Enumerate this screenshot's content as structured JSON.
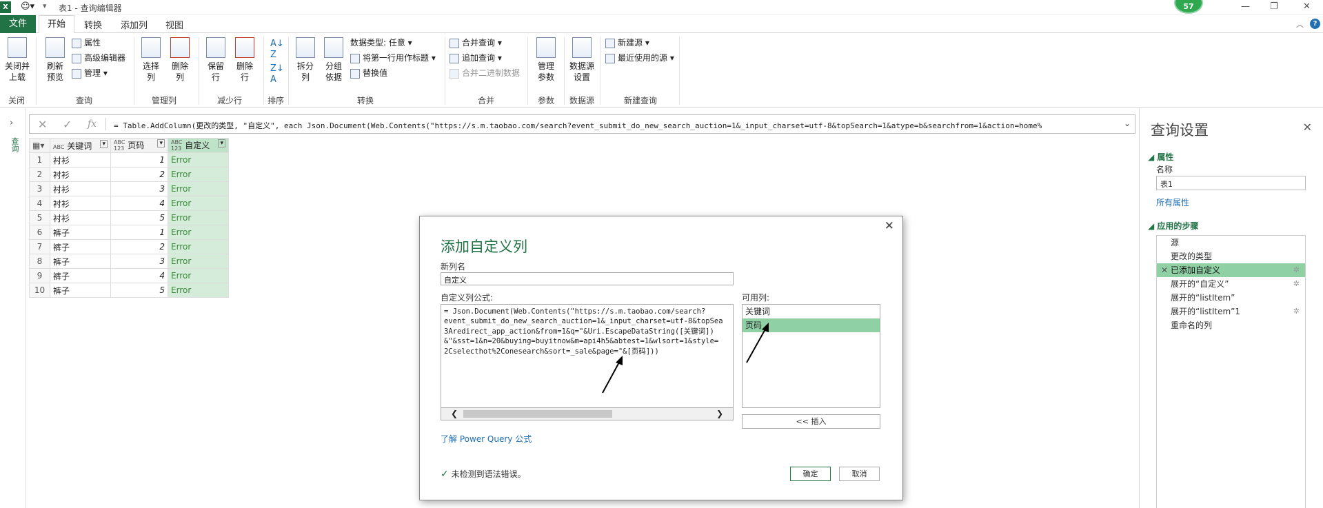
{
  "window": {
    "title": "表1 - 查询编辑器",
    "avatar_text": "57",
    "help": "?"
  },
  "tabs": {
    "file": "文件",
    "home": "开始",
    "transform": "转换",
    "add_column": "添加列",
    "view": "视图"
  },
  "ribbon": {
    "close_load": "关闭并\n上载",
    "refresh_preview": "刷新\n预览",
    "properties": "属性",
    "advanced_editor": "高级编辑器",
    "manage": "管理",
    "choose_columns": "选择\n列",
    "remove_columns": "删除\n列",
    "keep_rows": "保留\n行",
    "remove_rows": "删除\n行",
    "split_column": "拆分\n列",
    "group_by": "分组\n依据",
    "data_type": "数据类型: 任意",
    "use_first_row": "将第一行用作标题",
    "replace_values": "替换值",
    "merge_queries": "合并查询",
    "append_queries": "追加查询",
    "combine_binaries": "合并二进制数据",
    "manage_params": "管理\n参数",
    "data_source_settings": "数据源\n设置",
    "new_source": "新建源",
    "recent_sources": "最近使用的源",
    "groups": {
      "close": "关闭",
      "query": "查询",
      "manage_columns": "管理列",
      "reduce_rows": "减少行",
      "sort": "排序",
      "transform": "转换",
      "combine": "合并",
      "parameters": "参数",
      "data_sources": "数据源",
      "new_query": "新建查询"
    }
  },
  "formula_bar": {
    "fx": "fx",
    "text": "= Table.AddColumn(更改的类型, \"自定义\", each Json.Document(Web.Contents(\"https://s.m.taobao.com/search?event_submit_do_new_search_auction=1&_input_charset=utf-8&topSearch=1&atype=b&searchfrom=1&action=home%"
  },
  "left_pane": {
    "label": "查询"
  },
  "table": {
    "columns": [
      {
        "type": "ABC",
        "name": "关键词"
      },
      {
        "type": "ABC\n123",
        "name": "页码"
      },
      {
        "type": "ABC\n123",
        "name": "自定义"
      }
    ],
    "rows": [
      [
        "1",
        "衬衫",
        "1",
        "Error"
      ],
      [
        "2",
        "衬衫",
        "2",
        "Error"
      ],
      [
        "3",
        "衬衫",
        "3",
        "Error"
      ],
      [
        "4",
        "衬衫",
        "4",
        "Error"
      ],
      [
        "5",
        "衬衫",
        "5",
        "Error"
      ],
      [
        "6",
        "裤子",
        "1",
        "Error"
      ],
      [
        "7",
        "裤子",
        "2",
        "Error"
      ],
      [
        "8",
        "裤子",
        "3",
        "Error"
      ],
      [
        "9",
        "裤子",
        "4",
        "Error"
      ],
      [
        "10",
        "裤子",
        "5",
        "Error"
      ]
    ]
  },
  "query_settings": {
    "title": "查询设置",
    "properties_section": "属性",
    "name_label": "名称",
    "name_value": "表1",
    "all_properties": "所有属性",
    "applied_steps_section": "应用的步骤",
    "steps": [
      "源",
      "更改的类型",
      "已添加自定义",
      "展开的“自定义”",
      "展开的“listItem”",
      "展开的“listItem”1",
      "重命名的列"
    ]
  },
  "dialog": {
    "title": "添加自定义列",
    "new_col_label": "新列名",
    "new_col_value": "自定义",
    "formula_label": "自定义列公式:",
    "formula": "= Json.Document(Web.Contents(\"https://s.m.taobao.com/search?\nevent_submit_do_new_search_auction=1&_input_charset=utf-8&topSea\n3Aredirect_app_action&from=1&q=\"&Uri.EscapeDataString([关键词])\n&\"&sst=1&n=20&buying=buyitnow&m=api4h5&abtest=1&wlsort=1&style=\n2Cselecthot%2Conesearch&sort=_sale&page=\"&[页码]))",
    "available_label": "可用列:",
    "available": [
      "关键词",
      "页码"
    ],
    "insert": "<< 插入",
    "learn_link": "了解 Power Query 公式",
    "status": "未检测到语法错误。",
    "ok": "确定",
    "cancel": "取消"
  }
}
